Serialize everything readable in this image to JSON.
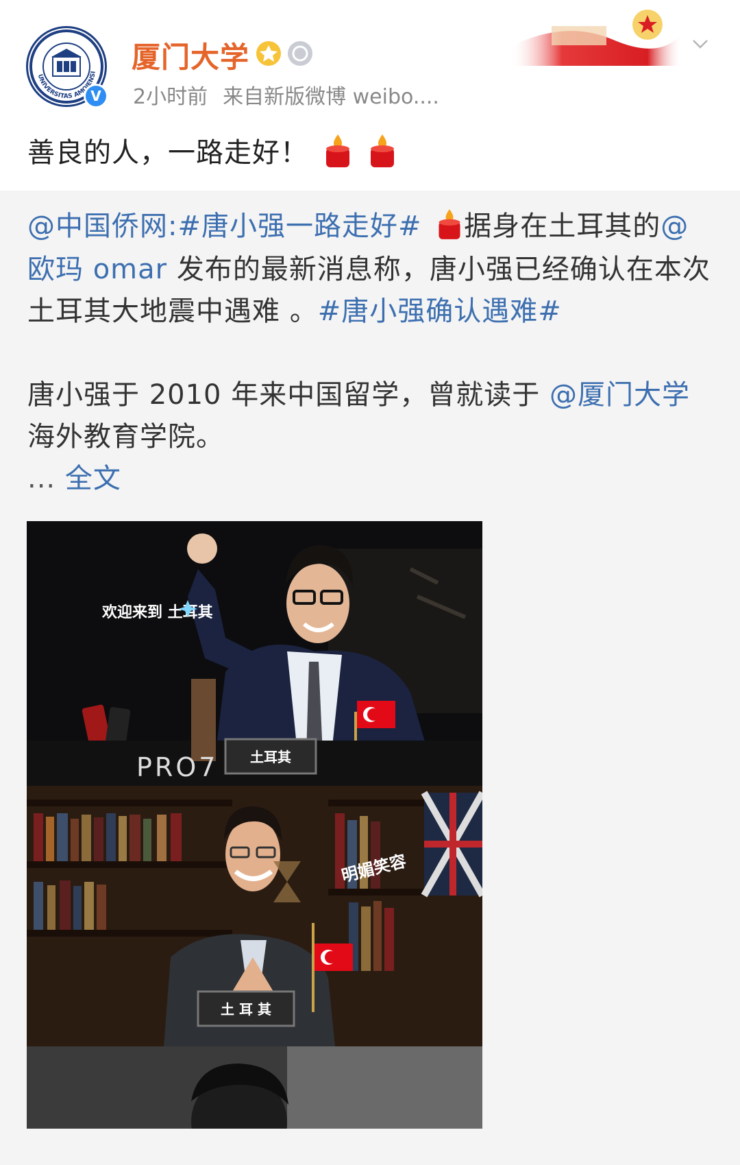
{
  "header": {
    "account_name": "厦门大学",
    "timestamp": "2小时前",
    "source": "来自新版微博 weibo....",
    "avatar_label": "UNIVERSITAS AMOIENSIS",
    "verified_mark": "V"
  },
  "post": {
    "text": "善良的人，一路走好！"
  },
  "repost": {
    "mention_source": "@中国侨网",
    "colon": ":",
    "hashtag1": "#唐小强一路走好#",
    "text1": "据身在土耳其的",
    "mention_omar": "@欧玛 omar",
    "text2": "发布的最新消息称，唐小强已经确认在本次土耳其大地震中遇难 。",
    "hashtag2": "#唐小强确认遇难#",
    "para2_text": "唐小强于 2010 年来中国留学，曾就读于",
    "mention_xmu": "@厦门大学",
    "para2_end": "海外教育学院。",
    "ellipsis": "...",
    "full_text_link": "全文"
  },
  "media": {
    "panel1_caption": "欢迎来到 土耳其",
    "panel1_desk_label": "土耳其",
    "panel1_brand": "PRO7",
    "panel2_caption": "明媚笑容",
    "panel2_desk_label": "土 耳 其"
  },
  "colors": {
    "name": "#e5642a",
    "link": "#3d6fb0",
    "meta": "#888888",
    "repost_bg": "#f4f4f4"
  },
  "icons": [
    "verified-icon",
    "gold-badge-icon",
    "silver-badge-icon",
    "chevron-down-icon",
    "candle-icon"
  ]
}
